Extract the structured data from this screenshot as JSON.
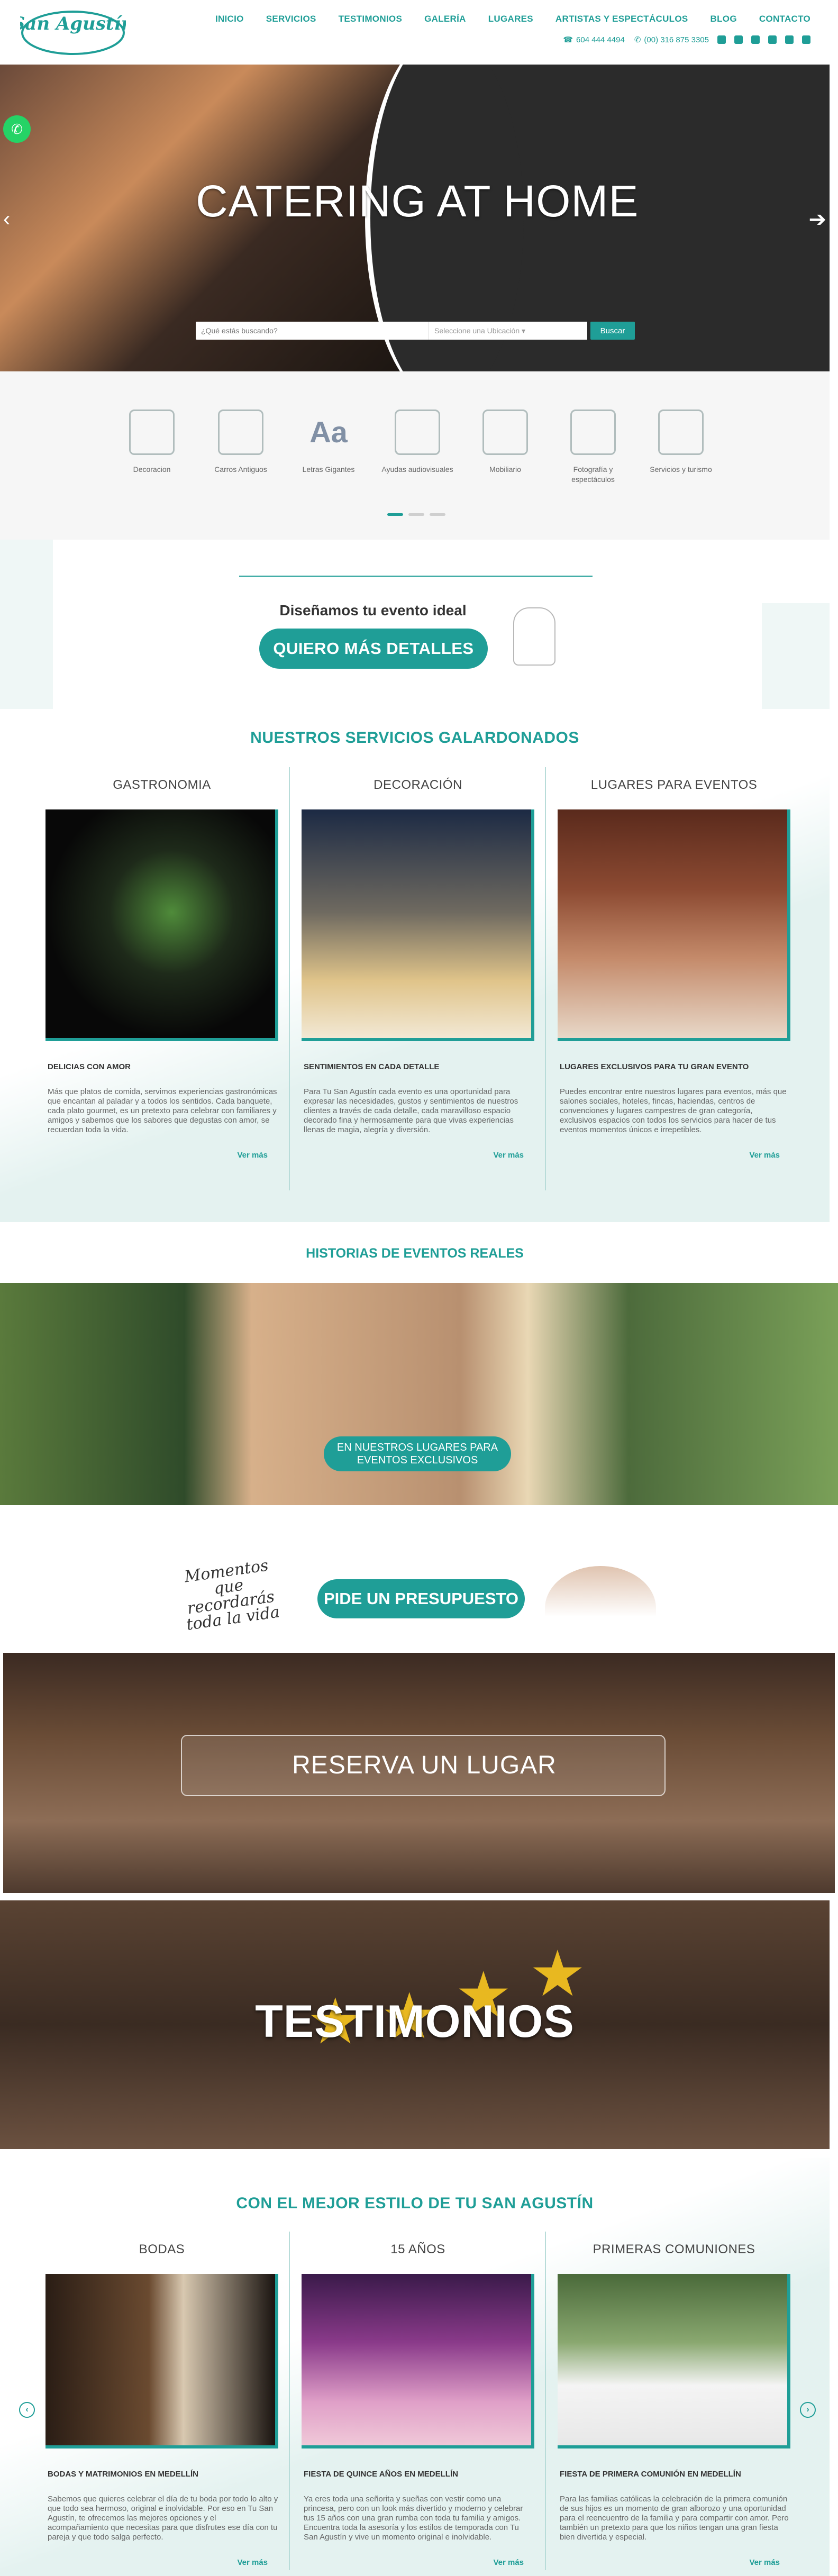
{
  "header": {
    "logo": "San Agustín",
    "nav": [
      "INICIO",
      "SERVICIOS",
      "TESTIMONIOS",
      "GALERÍA",
      "LUGARES",
      "ARTISTAS Y ESPECTÁCULOS",
      "BLOG",
      "CONTACTO"
    ],
    "phone1": "604 444 4494",
    "phone2": "(00) 316 875 3305",
    "social": [
      "facebook-icon",
      "instagram-icon",
      "youtube-icon",
      "pinterest-icon",
      "flickr-icon",
      "whatsapp-icon"
    ]
  },
  "hero": {
    "title": "CATERING AT HOME",
    "search_placeholder": "¿Qué estás buscando?",
    "location_placeholder": "Seleccione una Ubicación",
    "search_button": "Buscar"
  },
  "categories": [
    {
      "label": "Decoracion"
    },
    {
      "label": "Carros Antiguos"
    },
    {
      "label": "Letras Gigantes"
    },
    {
      "label": "Ayudas audiovisuales"
    },
    {
      "label": "Mobiliario"
    },
    {
      "label": "Fotografía y espectáculos"
    },
    {
      "label": "Servicios y turismo"
    }
  ],
  "design": {
    "title": "Diseñamos tu evento ideal",
    "button": "QUIERO MÁS DETALLES"
  },
  "services": {
    "title": "NUESTROS SERVICIOS GALARDONADOS",
    "cols": [
      {
        "title": "GASTRONOMIA",
        "sub": "DELICIAS CON AMOR",
        "text": "Más que platos de comida, servimos experiencias gastronómicas que encantan al paladar y a todos los sentidos. Cada banquete, cada plato gourmet, es un pretexto para celebrar con familiares y amigos y sabemos que los sabores que degustas con amor, se recuerdan toda la vida.",
        "more": "Ver más"
      },
      {
        "title": "DECORACIÓN",
        "sub": "SENTIMIENTOS EN CADA DETALLE",
        "text": "Para Tu San Agustín cada evento es una oportunidad para expresar las necesidades, gustos y sentimientos de nuestros clientes a través de cada detalle, cada maravilloso espacio decorado fina y hermosamente para que vivas experiencias llenas de magia, alegría y diversión.",
        "more": "Ver más"
      },
      {
        "title": "LUGARES PARA EVENTOS",
        "sub": "LUGARES EXCLUSIVOS PARA TU GRAN EVENTO",
        "text": "Puedes encontrar entre nuestros lugares para eventos, más que salones sociales, hoteles, fincas, haciendas, centros de convenciones y lugares campestres de gran categoría, exclusivos espacios con todos los servicios para hacer de tus eventos momentos únicos e irrepetibles.",
        "more": "Ver más"
      }
    ]
  },
  "historias": {
    "title": "HISTORIAS DE EVENTOS REALES",
    "button": "EN NUESTROS LUGARES PARA EVENTOS EXCLUSIVOS"
  },
  "presupuesto": {
    "script": "Momentos que recordarás toda la vida",
    "button": "PIDE UN PRESUPUESTO"
  },
  "reserva": {
    "title": "RESERVA UN LUGAR"
  },
  "testimonios": {
    "title": "TESTIMONIOS"
  },
  "estilo": {
    "title": "CON EL MEJOR ESTILO DE TU SAN AGUSTÍN",
    "cols": [
      {
        "title": "BODAS",
        "sub": "BODAS Y MATRIMONIOS EN MEDELLÍN",
        "text": "Sabemos que quieres celebrar el día de tu boda por todo lo alto y que todo sea hermoso, original e inolvidable. Por eso en Tu San Agustín, te ofrecemos las mejores opciones y el acompañamiento que necesitas para que disfrutes ese día con tu pareja y que todo salga perfecto.",
        "more": "Ver más"
      },
      {
        "title": "15 AÑOS",
        "sub": "FIESTA DE QUINCE AÑOS EN MEDELLÍN",
        "text": "Ya eres toda una señorita y sueñas con vestir como una princesa, pero con un look más divertido y moderno y celebrar tus 15 años con una gran rumba con toda tu familia y amigos. Encuentra toda la asesoría y los estilos de temporada con Tu San Agustín y vive un momento original e inolvidable.",
        "more": "Ver más"
      },
      {
        "title": "PRIMERAS COMUNIONES",
        "sub": "FIESTA DE PRIMERA COMUNIÓN EN MEDELLÍN",
        "text": "Para las familias católicas la celebración de la primera comunión de sus hijos es un momento de gran alborozo y una oportunidad para el reencuentro de la familia y para compartir con amor. Pero también un pretexto para que los niños tengan una gran fiesta bien divertida y especial.",
        "more": "Ver más"
      }
    ]
  }
}
